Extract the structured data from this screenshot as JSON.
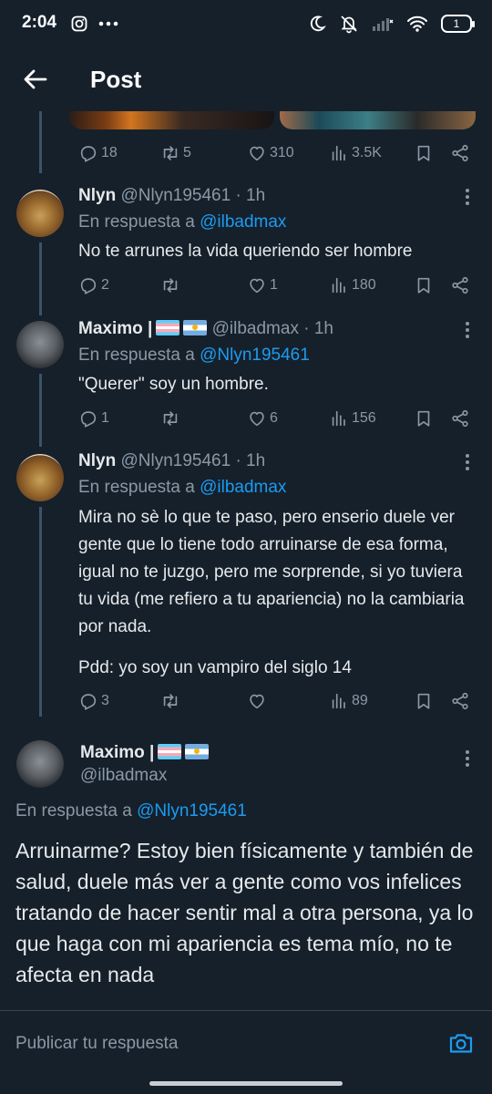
{
  "status_bar": {
    "time": "2:04",
    "battery": "1"
  },
  "header": {
    "title": "Post"
  },
  "prev_post_actions": {
    "replies": "18",
    "reposts": "5",
    "likes": "310",
    "views": "3.5K"
  },
  "replies": [
    {
      "name": "Nlyn",
      "handle": "@Nlyn195461",
      "time": "· 1h",
      "reply_prefix": "En respuesta a",
      "reply_to": "@ilbadmax",
      "text": "No te arrunes la vida queriendo ser hombre",
      "replies": "2",
      "reposts": "",
      "likes": "1",
      "views": "180"
    },
    {
      "name": "Maximo |",
      "handle": "@ilbadmax",
      "time": "· 1h",
      "reply_prefix": "En respuesta a",
      "reply_to": "@Nlyn195461",
      "text": "\"Querer\" soy un hombre.",
      "replies": "1",
      "reposts": "",
      "likes": "6",
      "views": "156"
    },
    {
      "name": "Nlyn",
      "handle": "@Nlyn195461",
      "time": "· 1h",
      "reply_prefix": "En respuesta a",
      "reply_to": "@ilbadmax",
      "text": "Mira no sè lo que te paso, pero enserio duele ver gente que lo tiene todo arruinarse de esa forma, igual no te juzgo, pero me sorprende, si yo tuviera tu vida (me refiero a tu apariencia) no la cambiaria por nada.",
      "text2": "Pdd: yo soy un vampiro del siglo 14",
      "replies": "3",
      "reposts": "",
      "likes": "",
      "views": "89"
    }
  ],
  "main_post": {
    "name": "Maximo |",
    "handle": "@ilbadmax",
    "reply_prefix": "En respuesta a",
    "reply_to": "@Nlyn195461",
    "text": "Arruinarme? Estoy bien físicamente y también de salud, duele más ver a gente como vos infelices tratando de hacer sentir mal a otra persona, ya lo que haga con mi apariencia es tema mío, no te afecta en nada"
  },
  "composer": {
    "placeholder": "Publicar tu respuesta"
  },
  "icons": [
    "back-arrow-icon",
    "reply-icon",
    "repost-icon",
    "like-icon",
    "views-icon",
    "bookmark-icon",
    "share-icon",
    "more-icon",
    "camera-icon"
  ],
  "colors": {
    "background": "#15202b",
    "accent": "#1d9bf0",
    "muted": "#8b98a5",
    "text": "#e7e9ea"
  }
}
